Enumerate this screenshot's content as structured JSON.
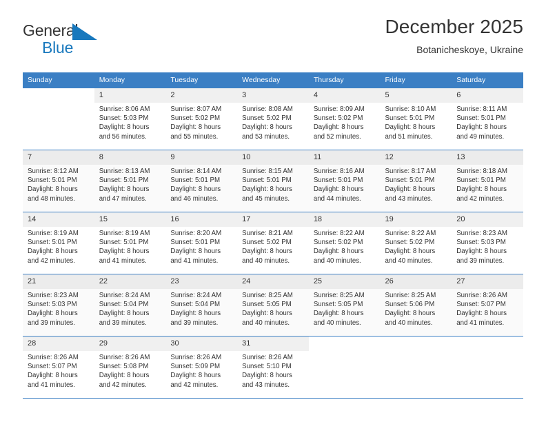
{
  "brand": {
    "line1": "General",
    "line2": "Blue",
    "mark_icon": "triangle-flag-icon",
    "color_blue": "#1878bd"
  },
  "header": {
    "title": "December 2025",
    "subtitle": "Botanicheskoye, Ukraine"
  },
  "calendar": {
    "header_color": "#3b7fc4",
    "weekdays": [
      "Sunday",
      "Monday",
      "Tuesday",
      "Wednesday",
      "Thursday",
      "Friday",
      "Saturday"
    ],
    "weeks": [
      [
        {
          "day": "",
          "sunrise": "",
          "sunset": "",
          "daylight1": "",
          "daylight2": ""
        },
        {
          "day": "1",
          "sunrise": "Sunrise: 8:06 AM",
          "sunset": "Sunset: 5:03 PM",
          "daylight1": "Daylight: 8 hours",
          "daylight2": "and 56 minutes."
        },
        {
          "day": "2",
          "sunrise": "Sunrise: 8:07 AM",
          "sunset": "Sunset: 5:02 PM",
          "daylight1": "Daylight: 8 hours",
          "daylight2": "and 55 minutes."
        },
        {
          "day": "3",
          "sunrise": "Sunrise: 8:08 AM",
          "sunset": "Sunset: 5:02 PM",
          "daylight1": "Daylight: 8 hours",
          "daylight2": "and 53 minutes."
        },
        {
          "day": "4",
          "sunrise": "Sunrise: 8:09 AM",
          "sunset": "Sunset: 5:02 PM",
          "daylight1": "Daylight: 8 hours",
          "daylight2": "and 52 minutes."
        },
        {
          "day": "5",
          "sunrise": "Sunrise: 8:10 AM",
          "sunset": "Sunset: 5:01 PM",
          "daylight1": "Daylight: 8 hours",
          "daylight2": "and 51 minutes."
        },
        {
          "day": "6",
          "sunrise": "Sunrise: 8:11 AM",
          "sunset": "Sunset: 5:01 PM",
          "daylight1": "Daylight: 8 hours",
          "daylight2": "and 49 minutes."
        }
      ],
      [
        {
          "day": "7",
          "sunrise": "Sunrise: 8:12 AM",
          "sunset": "Sunset: 5:01 PM",
          "daylight1": "Daylight: 8 hours",
          "daylight2": "and 48 minutes."
        },
        {
          "day": "8",
          "sunrise": "Sunrise: 8:13 AM",
          "sunset": "Sunset: 5:01 PM",
          "daylight1": "Daylight: 8 hours",
          "daylight2": "and 47 minutes."
        },
        {
          "day": "9",
          "sunrise": "Sunrise: 8:14 AM",
          "sunset": "Sunset: 5:01 PM",
          "daylight1": "Daylight: 8 hours",
          "daylight2": "and 46 minutes."
        },
        {
          "day": "10",
          "sunrise": "Sunrise: 8:15 AM",
          "sunset": "Sunset: 5:01 PM",
          "daylight1": "Daylight: 8 hours",
          "daylight2": "and 45 minutes."
        },
        {
          "day": "11",
          "sunrise": "Sunrise: 8:16 AM",
          "sunset": "Sunset: 5:01 PM",
          "daylight1": "Daylight: 8 hours",
          "daylight2": "and 44 minutes."
        },
        {
          "day": "12",
          "sunrise": "Sunrise: 8:17 AM",
          "sunset": "Sunset: 5:01 PM",
          "daylight1": "Daylight: 8 hours",
          "daylight2": "and 43 minutes."
        },
        {
          "day": "13",
          "sunrise": "Sunrise: 8:18 AM",
          "sunset": "Sunset: 5:01 PM",
          "daylight1": "Daylight: 8 hours",
          "daylight2": "and 42 minutes."
        }
      ],
      [
        {
          "day": "14",
          "sunrise": "Sunrise: 8:19 AM",
          "sunset": "Sunset: 5:01 PM",
          "daylight1": "Daylight: 8 hours",
          "daylight2": "and 42 minutes."
        },
        {
          "day": "15",
          "sunrise": "Sunrise: 8:19 AM",
          "sunset": "Sunset: 5:01 PM",
          "daylight1": "Daylight: 8 hours",
          "daylight2": "and 41 minutes."
        },
        {
          "day": "16",
          "sunrise": "Sunrise: 8:20 AM",
          "sunset": "Sunset: 5:01 PM",
          "daylight1": "Daylight: 8 hours",
          "daylight2": "and 41 minutes."
        },
        {
          "day": "17",
          "sunrise": "Sunrise: 8:21 AM",
          "sunset": "Sunset: 5:02 PM",
          "daylight1": "Daylight: 8 hours",
          "daylight2": "and 40 minutes."
        },
        {
          "day": "18",
          "sunrise": "Sunrise: 8:22 AM",
          "sunset": "Sunset: 5:02 PM",
          "daylight1": "Daylight: 8 hours",
          "daylight2": "and 40 minutes."
        },
        {
          "day": "19",
          "sunrise": "Sunrise: 8:22 AM",
          "sunset": "Sunset: 5:02 PM",
          "daylight1": "Daylight: 8 hours",
          "daylight2": "and 40 minutes."
        },
        {
          "day": "20",
          "sunrise": "Sunrise: 8:23 AM",
          "sunset": "Sunset: 5:03 PM",
          "daylight1": "Daylight: 8 hours",
          "daylight2": "and 39 minutes."
        }
      ],
      [
        {
          "day": "21",
          "sunrise": "Sunrise: 8:23 AM",
          "sunset": "Sunset: 5:03 PM",
          "daylight1": "Daylight: 8 hours",
          "daylight2": "and 39 minutes."
        },
        {
          "day": "22",
          "sunrise": "Sunrise: 8:24 AM",
          "sunset": "Sunset: 5:04 PM",
          "daylight1": "Daylight: 8 hours",
          "daylight2": "and 39 minutes."
        },
        {
          "day": "23",
          "sunrise": "Sunrise: 8:24 AM",
          "sunset": "Sunset: 5:04 PM",
          "daylight1": "Daylight: 8 hours",
          "daylight2": "and 39 minutes."
        },
        {
          "day": "24",
          "sunrise": "Sunrise: 8:25 AM",
          "sunset": "Sunset: 5:05 PM",
          "daylight1": "Daylight: 8 hours",
          "daylight2": "and 40 minutes."
        },
        {
          "day": "25",
          "sunrise": "Sunrise: 8:25 AM",
          "sunset": "Sunset: 5:05 PM",
          "daylight1": "Daylight: 8 hours",
          "daylight2": "and 40 minutes."
        },
        {
          "day": "26",
          "sunrise": "Sunrise: 8:25 AM",
          "sunset": "Sunset: 5:06 PM",
          "daylight1": "Daylight: 8 hours",
          "daylight2": "and 40 minutes."
        },
        {
          "day": "27",
          "sunrise": "Sunrise: 8:26 AM",
          "sunset": "Sunset: 5:07 PM",
          "daylight1": "Daylight: 8 hours",
          "daylight2": "and 41 minutes."
        }
      ],
      [
        {
          "day": "28",
          "sunrise": "Sunrise: 8:26 AM",
          "sunset": "Sunset: 5:07 PM",
          "daylight1": "Daylight: 8 hours",
          "daylight2": "and 41 minutes."
        },
        {
          "day": "29",
          "sunrise": "Sunrise: 8:26 AM",
          "sunset": "Sunset: 5:08 PM",
          "daylight1": "Daylight: 8 hours",
          "daylight2": "and 42 minutes."
        },
        {
          "day": "30",
          "sunrise": "Sunrise: 8:26 AM",
          "sunset": "Sunset: 5:09 PM",
          "daylight1": "Daylight: 8 hours",
          "daylight2": "and 42 minutes."
        },
        {
          "day": "31",
          "sunrise": "Sunrise: 8:26 AM",
          "sunset": "Sunset: 5:10 PM",
          "daylight1": "Daylight: 8 hours",
          "daylight2": "and 43 minutes."
        },
        {
          "day": "",
          "sunrise": "",
          "sunset": "",
          "daylight1": "",
          "daylight2": ""
        },
        {
          "day": "",
          "sunrise": "",
          "sunset": "",
          "daylight1": "",
          "daylight2": ""
        },
        {
          "day": "",
          "sunrise": "",
          "sunset": "",
          "daylight1": "",
          "daylight2": ""
        }
      ]
    ]
  }
}
